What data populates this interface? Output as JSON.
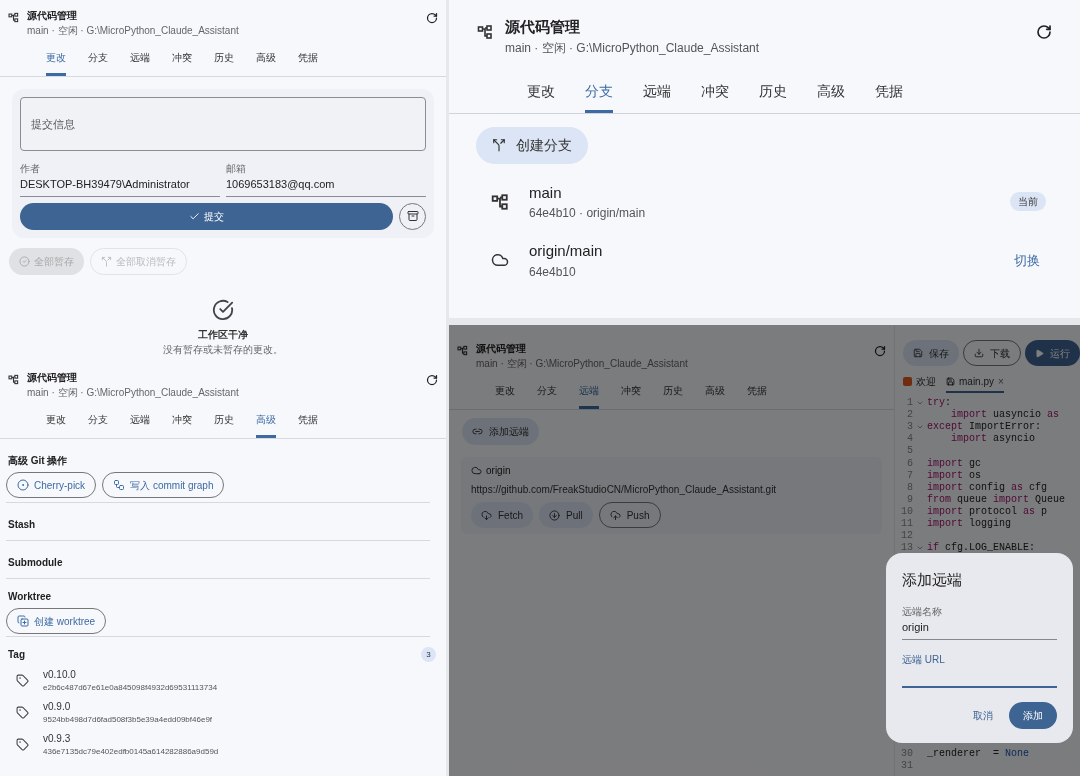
{
  "changes_panel": {
    "header": {
      "title": "源代码管理",
      "subtitle": "main · 空闲 · G:\\MicroPython_Claude_Assistant"
    },
    "tabs": [
      {
        "label": "更改",
        "selected": true
      },
      {
        "label": "分支",
        "selected": false
      },
      {
        "label": "远端",
        "selected": false
      },
      {
        "label": "冲突",
        "selected": false
      },
      {
        "label": "历史",
        "selected": false
      },
      {
        "label": "高级",
        "selected": false
      },
      {
        "label": "凭据",
        "selected": false
      }
    ],
    "commit_message": {
      "placeholder": "提交信息"
    },
    "author": {
      "label": "作者",
      "value": "DESKTOP-BH39479\\Administrator"
    },
    "email": {
      "label": "邮箱",
      "value": "1069653183@qq.com"
    },
    "commit_button": "提交",
    "bulk_actions": [
      {
        "label": "全部暂存",
        "kind": "stage",
        "disabled": true
      },
      {
        "label": "全部取消暂存",
        "kind": "unstage",
        "disabled": true
      }
    ],
    "empty_state": {
      "title": "工作区干净",
      "message": "没有暂存或未暂存的更改。"
    }
  },
  "advanced_panel": {
    "header": {
      "title": "源代码管理",
      "subtitle": "main · 空闲 · G:\\MicroPython_Claude_Assistant"
    },
    "tabs": [
      {
        "label": "更改",
        "selected": false
      },
      {
        "label": "分支",
        "selected": false
      },
      {
        "label": "远端",
        "selected": false
      },
      {
        "label": "冲突",
        "selected": false
      },
      {
        "label": "历史",
        "selected": false
      },
      {
        "label": "高级",
        "selected": true
      },
      {
        "label": "凭据",
        "selected": false
      }
    ],
    "operations_title": "高级 Git 操作",
    "operations": [
      {
        "label": "Cherry-pick",
        "kind": "cherry_pick"
      },
      {
        "label": "写入 commit graph",
        "kind": "commit_graph"
      }
    ],
    "sections": [
      {
        "title": "Stash"
      },
      {
        "title": "Submodule"
      }
    ],
    "worktree": {
      "title": "Worktree",
      "button": "创建 worktree"
    },
    "tags": {
      "title": "Tag",
      "count": "3",
      "items": [
        {
          "name": "v0.10.0",
          "hash": "e2b6c487d67e61e0a845098f4932d69531113734"
        },
        {
          "name": "v0.9.0",
          "hash": "9524bb498d7d6fad508f3b5e39a4edd09bf46e9f"
        },
        {
          "name": "v0.9.3",
          "hash": "436e7135dc79e402edfb0145a614282886a9d59d"
        }
      ]
    }
  },
  "branches_panel": {
    "header": {
      "title": "源代码管理",
      "subtitle": "main · 空闲 · G:\\MicroPython_Claude_Assistant"
    },
    "tabs": [
      {
        "label": "更改",
        "selected": false
      },
      {
        "label": "分支",
        "selected": true
      },
      {
        "label": "远端",
        "selected": false
      },
      {
        "label": "冲突",
        "selected": false
      },
      {
        "label": "历史",
        "selected": false
      },
      {
        "label": "高级",
        "selected": false
      },
      {
        "label": "凭据",
        "selected": false
      }
    ],
    "create_button": "创建分支",
    "branches": [
      {
        "name": "main",
        "detail": "64e4b10 · origin/main",
        "kind": "local",
        "badge": "当前"
      },
      {
        "name": "origin/main",
        "detail": "64e4b10",
        "kind": "remote",
        "action": "切换"
      }
    ]
  },
  "remotes_panel": {
    "header": {
      "title": "源代码管理",
      "subtitle": "main · 空闲 · G:\\MicroPython_Claude_Assistant"
    },
    "tabs": [
      {
        "label": "更改",
        "selected": false
      },
      {
        "label": "分支",
        "selected": false
      },
      {
        "label": "远端",
        "selected": true
      },
      {
        "label": "冲突",
        "selected": false
      },
      {
        "label": "历史",
        "selected": false
      },
      {
        "label": "高级",
        "selected": false
      },
      {
        "label": "凭据",
        "selected": false
      }
    ],
    "add_button": "添加远端",
    "remote": {
      "name": "origin",
      "url": "https://github.com/FreakStudioCN/MicroPython_Claude_Assistant.git",
      "actions": [
        {
          "label": "Fetch",
          "kind": "fetch"
        },
        {
          "label": "Pull",
          "kind": "pull"
        },
        {
          "label": "Push",
          "kind": "push"
        }
      ]
    },
    "editor": {
      "toolbar": [
        {
          "label": "保存",
          "kind": "save"
        },
        {
          "label": "下载",
          "kind": "download"
        },
        {
          "label": "运行",
          "kind": "run"
        }
      ],
      "tabs": [
        {
          "label": "欢迎",
          "kind": "welcome",
          "selected": false
        },
        {
          "label": "main.py",
          "kind": "file",
          "selected": true,
          "close": "×"
        }
      ],
      "lines_top": [
        {
          "number": "1",
          "foldable": true,
          "segments": [
            {
              "text": "try",
              "kind": "keyword"
            },
            {
              "text": ":",
              "kind": "plain"
            }
          ]
        },
        {
          "number": "2",
          "foldable": false,
          "indented": true,
          "segments": [
            {
              "text": "import",
              "kind": "keyword"
            },
            {
              "text": " uasyncio ",
              "kind": "plain"
            },
            {
              "text": "as",
              "kind": "keyword"
            }
          ]
        },
        {
          "number": "3",
          "foldable": true,
          "segments": [
            {
              "text": "except",
              "kind": "keyword"
            },
            {
              "text": " ImportError:",
              "kind": "plain"
            }
          ]
        },
        {
          "number": "4",
          "foldable": false,
          "indented": true,
          "segments": [
            {
              "text": "import",
              "kind": "keyword"
            },
            {
              "text": " asyncio",
              "kind": "plain"
            }
          ]
        },
        {
          "number": "5",
          "foldable": false
        },
        {
          "number": "6",
          "foldable": false,
          "segments": [
            {
              "text": "import",
              "kind": "keyword"
            },
            {
              "text": " gc",
              "kind": "plain"
            }
          ]
        },
        {
          "number": "7",
          "foldable": false,
          "segments": [
            {
              "text": "import",
              "kind": "keyword"
            },
            {
              "text": " os",
              "kind": "plain"
            }
          ]
        },
        {
          "number": "8",
          "foldable": false,
          "segments": [
            {
              "text": "import",
              "kind": "keyword"
            },
            {
              "text": " config ",
              "kind": "plain"
            },
            {
              "text": "as",
              "kind": "keyword"
            },
            {
              "text": " cfg",
              "kind": "plain"
            }
          ]
        },
        {
          "number": "9",
          "foldable": false,
          "segments": [
            {
              "text": "from",
              "kind": "keyword"
            },
            {
              "text": " queue ",
              "kind": "plain"
            },
            {
              "text": "import",
              "kind": "keyword"
            },
            {
              "text": " Queue",
              "kind": "plain"
            }
          ]
        },
        {
          "number": "10",
          "foldable": false,
          "segments": [
            {
              "text": "import",
              "kind": "keyword"
            },
            {
              "text": " protocol ",
              "kind": "plain"
            },
            {
              "text": "as",
              "kind": "keyword"
            },
            {
              "text": " p",
              "kind": "plain"
            }
          ]
        },
        {
          "number": "11",
          "foldable": false,
          "segments": [
            {
              "text": "import",
              "kind": "keyword"
            },
            {
              "text": " logging",
              "kind": "plain"
            }
          ]
        },
        {
          "number": "12",
          "foldable": false
        },
        {
          "number": "13",
          "foldable": true,
          "segments": [
            {
              "text": "if",
              "kind": "keyword"
            },
            {
              "text": " cfg.LOG_ENABLE:",
              "kind": "plain"
            }
          ]
        }
      ],
      "lines_bottom": [
        {
          "number": "30",
          "foldable": false,
          "segments": [
            {
              "text": "_renderer  = ",
              "kind": "plain"
            },
            {
              "text": "None",
              "kind": "constant"
            }
          ]
        },
        {
          "number": "31",
          "foldable": false
        }
      ]
    },
    "dialog": {
      "title": "添加远端",
      "fields": [
        {
          "label": "远端名称",
          "value": "origin",
          "focused": false
        },
        {
          "label": "远端 URL",
          "focused": true
        }
      ],
      "cancel": "取消",
      "confirm": "添加"
    }
  }
}
